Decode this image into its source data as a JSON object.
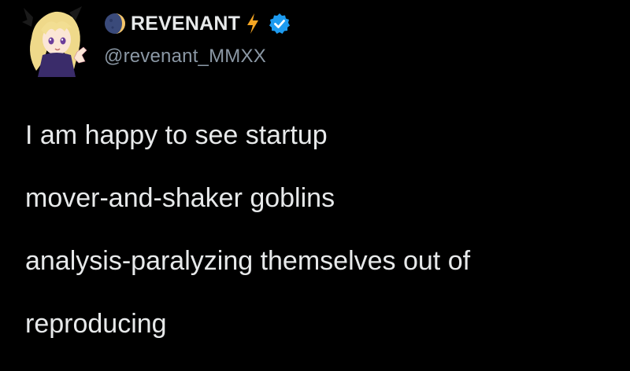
{
  "author": {
    "display_name": "REVENANT",
    "handle": "@revenant_MMXX",
    "avatar_icon": "anime-avatar-icon",
    "name_prefix_icon": "moon-icon",
    "name_suffix_icon": "lightning-bolt-icon",
    "badge_icon": "verified-badge-icon",
    "verified_color": "#1d9bf0",
    "bolt_color": "#f5a623"
  },
  "tweet": {
    "lines": [
      "I am happy to see startup",
      "mover-and-shaker goblins",
      "analysis-paralyzing themselves out of",
      "reproducing"
    ]
  },
  "colors": {
    "background": "#000000",
    "text": "#e7e9ea",
    "secondary_text": "#8b98a5"
  }
}
